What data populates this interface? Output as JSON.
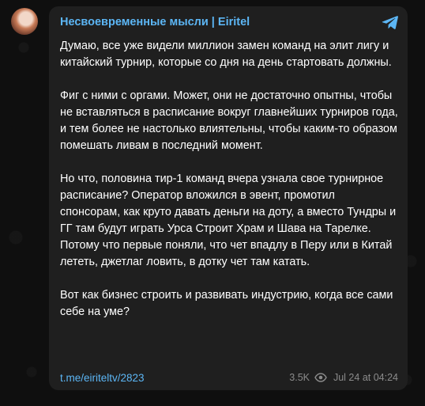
{
  "post": {
    "channel_name": "Несвоевременные мысли | Eiritel",
    "paragraphs": [
      "Думаю, все уже видели миллион замен команд на элит лигу и китайский турнир, которые со дня на день стартовать должны.",
      "Фиг с ними с оргами. Может, они не достаточно опытны, чтобы не вставляться в расписание вокруг главнейших турниров года, и тем более не настолько влиятельны, чтобы каким-то образом помешать ливам в последний момент.",
      "Но что, половина тир-1 команд вчера узнала свое турнирное расписание? Оператор вложился в эвент, промотил спонсорам, как круто давать деньги на доту, а вместо Тундры и ГГ там будут играть Урса Строит Храм и Шава на Тарелке. Потому что первые поняли, что чет впадлу в Перу или в Китай лететь, джетлаг ловить, в дотку чет там катать.",
      "Вот как бизнес строить и развивать индустрию, когда все сами себе на уме?"
    ],
    "link": "t.me/eiriteltv/2823",
    "views": "3.5K",
    "timestamp": "Jul 24 at 04:24"
  },
  "icons": {
    "share": "telegram-plane-icon",
    "views": "eye-icon"
  },
  "colors": {
    "background": "#0f0f0f",
    "bubble": "#1f1f1f",
    "accent": "#5cb6f5",
    "text": "#ffffff",
    "meta": "#8b8b8b"
  }
}
